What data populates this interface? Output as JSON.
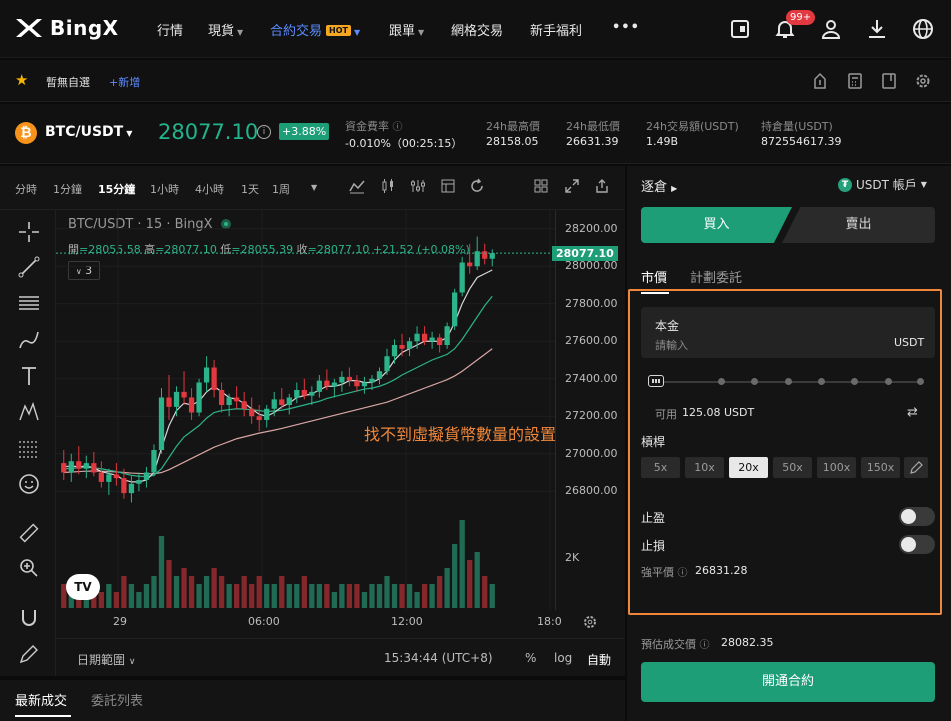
{
  "brand": {
    "name": "BingX"
  },
  "nav": {
    "items": [
      {
        "label": "行情",
        "caret": false
      },
      {
        "label": "現貨",
        "caret": true
      },
      {
        "label": "合約交易",
        "caret": true,
        "badge": "HOT",
        "active": true
      },
      {
        "label": "跟單",
        "caret": true
      },
      {
        "label": "網格交易",
        "caret": false
      },
      {
        "label": "新手福利",
        "caret": false
      }
    ],
    "more": "•••",
    "notifications_badge": "99+"
  },
  "favorites": {
    "label": "暫無自選",
    "add_label": "+新增"
  },
  "ticker": {
    "pair": "BTC/USDT",
    "last_price": "28077.10",
    "change": "+3.88%",
    "stats": [
      {
        "label": "資金費率",
        "value": "-0.010%（00:25:15）"
      },
      {
        "label": "24h最高價",
        "value": "28158.05"
      },
      {
        "label": "24h最低價",
        "value": "26631.39"
      },
      {
        "label": "24h交易額(USDT)",
        "value": "1.49B"
      },
      {
        "label": "持倉量(USDT)",
        "value": "872554617.39"
      }
    ]
  },
  "chart_toolbar": {
    "timeframes": [
      "分時",
      "1分鐘",
      "15分鐘",
      "1小時",
      "4小時",
      "1天",
      "1周"
    ],
    "active": "15分鐘"
  },
  "chart_header": {
    "title": "BTC/USDT · 15 · BingX",
    "ohlc": {
      "open_label": "開",
      "open": "=28055.58",
      "high_label": "高",
      "high": "=28077.10",
      "low_label": "低",
      "low": "=28055.39",
      "close_label": "收",
      "close": "=28077.10",
      "change": "+21.52 (+0.08%)"
    },
    "indicator_count": "3"
  },
  "annotation": "找不到虛擬貨幣數量的設置",
  "chart_footer": {
    "date_range": "日期範圍",
    "clock": "15:34:44 (UTC+8)",
    "percent": "%",
    "log": "log",
    "auto": "自動"
  },
  "tv_logo": "TV",
  "chart_data": {
    "type": "candlestick",
    "price_ticks": [
      28200,
      28000,
      27800,
      27600,
      27400,
      27200,
      27000,
      26800
    ],
    "price_tick_labels": [
      "28200.00",
      "28000.00",
      "27800.00",
      "27600.00",
      "27400.00",
      "27200.00",
      "27000.00",
      "26800.00"
    ],
    "current_price_label": "28077.10",
    "volume_tick_label": "2K",
    "time_ticks": [
      "29",
      "06:00",
      "12:00",
      "18:0"
    ],
    "ylim": [
      26700,
      28300
    ],
    "ohlc": [
      [
        26950,
        27020,
        26860,
        26900
      ],
      [
        26900,
        27000,
        26850,
        26960
      ],
      [
        26960,
        27040,
        26890,
        26920
      ],
      [
        26920,
        26990,
        26870,
        26950
      ],
      [
        26950,
        27010,
        26880,
        26900
      ],
      [
        26900,
        26960,
        26820,
        26850
      ],
      [
        26850,
        26920,
        26780,
        26890
      ],
      [
        26890,
        26950,
        26830,
        26870
      ],
      [
        26870,
        26920,
        26760,
        26790
      ],
      [
        26790,
        26880,
        26740,
        26840
      ],
      [
        26840,
        26900,
        26800,
        26860
      ],
      [
        26860,
        26930,
        26820,
        26900
      ],
      [
        26900,
        27050,
        26880,
        27020
      ],
      [
        27020,
        27350,
        27000,
        27300
      ],
      [
        27300,
        27420,
        27180,
        27250
      ],
      [
        27250,
        27360,
        27200,
        27330
      ],
      [
        27330,
        27440,
        27260,
        27300
      ],
      [
        27300,
        27350,
        27180,
        27220
      ],
      [
        27220,
        27400,
        27200,
        27380
      ],
      [
        27380,
        27520,
        27330,
        27460
      ],
      [
        27460,
        27500,
        27300,
        27340
      ],
      [
        27340,
        27380,
        27220,
        27260
      ],
      [
        27260,
        27320,
        27200,
        27300
      ],
      [
        27300,
        27360,
        27240,
        27280
      ],
      [
        27280,
        27330,
        27200,
        27240
      ],
      [
        27240,
        27300,
        27160,
        27200
      ],
      [
        27200,
        27260,
        27120,
        27180
      ],
      [
        27180,
        27260,
        27140,
        27240
      ],
      [
        27240,
        27330,
        27200,
        27290
      ],
      [
        27290,
        27350,
        27240,
        27260
      ],
      [
        27260,
        27320,
        27210,
        27300
      ],
      [
        27300,
        27380,
        27270,
        27340
      ],
      [
        27340,
        27400,
        27290,
        27310
      ],
      [
        27310,
        27360,
        27260,
        27330
      ],
      [
        27330,
        27420,
        27300,
        27390
      ],
      [
        27390,
        27450,
        27340,
        27360
      ],
      [
        27360,
        27400,
        27300,
        27380
      ],
      [
        27380,
        27440,
        27330,
        27410
      ],
      [
        27410,
        27460,
        27360,
        27390
      ],
      [
        27390,
        27420,
        27330,
        27360
      ],
      [
        27360,
        27410,
        27320,
        27380
      ],
      [
        27380,
        27420,
        27340,
        27400
      ],
      [
        27400,
        27460,
        27370,
        27440
      ],
      [
        27440,
        27560,
        27420,
        27520
      ],
      [
        27520,
        27610,
        27480,
        27580
      ],
      [
        27580,
        27640,
        27520,
        27560
      ],
      [
        27560,
        27620,
        27520,
        27600
      ],
      [
        27600,
        27680,
        27560,
        27640
      ],
      [
        27640,
        27680,
        27580,
        27600
      ],
      [
        27600,
        27650,
        27560,
        27620
      ],
      [
        27620,
        27640,
        27540,
        27580
      ],
      [
        27580,
        27700,
        27560,
        27680
      ],
      [
        27680,
        27880,
        27660,
        27860
      ],
      [
        27860,
        28050,
        27840,
        28020
      ],
      [
        28020,
        28120,
        27960,
        28000
      ],
      [
        28000,
        28158,
        27980,
        28080
      ],
      [
        28080,
        28120,
        28010,
        28040
      ],
      [
        28040,
        28090,
        28000,
        28070
      ]
    ],
    "volume": [
      3,
      2,
      4,
      2,
      3,
      2,
      3,
      2,
      4,
      3,
      2,
      3,
      4,
      9,
      6,
      4,
      5,
      4,
      3,
      4,
      5,
      4,
      3,
      3,
      4,
      3,
      4,
      3,
      3,
      4,
      3,
      3,
      4,
      3,
      3,
      3,
      2,
      3,
      3,
      3,
      2,
      3,
      3,
      4,
      3,
      3,
      3,
      2,
      3,
      3,
      4,
      5,
      8,
      11,
      6,
      7,
      4,
      3
    ],
    "ma_fast": [
      26930,
      26935,
      26930,
      26935,
      26925,
      26905,
      26895,
      26885,
      26860,
      26850,
      26850,
      26860,
      26900,
      27030,
      27150,
      27230,
      27270,
      27260,
      27280,
      27330,
      27360,
      27330,
      27300,
      27290,
      27270,
      27240,
      27210,
      27200,
      27220,
      27250,
      27270,
      27300,
      27310,
      27320,
      27340,
      27360,
      27360,
      27370,
      27390,
      27390,
      27380,
      27380,
      27400,
      27440,
      27500,
      27540,
      27560,
      27580,
      27600,
      27600,
      27600,
      27620,
      27700,
      27800,
      27880,
      27940,
      27960,
      27980
    ],
    "ma_mid": [
      26920,
      26922,
      26925,
      26927,
      26925,
      26920,
      26912,
      26905,
      26895,
      26885,
      26880,
      26878,
      26885,
      26920,
      26980,
      27040,
      27090,
      27120,
      27150,
      27190,
      27220,
      27230,
      27235,
      27240,
      27238,
      27235,
      27230,
      27225,
      27228,
      27232,
      27240,
      27250,
      27260,
      27270,
      27280,
      27295,
      27305,
      27315,
      27325,
      27335,
      27345,
      27350,
      27360,
      27375,
      27395,
      27420,
      27440,
      27460,
      27480,
      27500,
      27515,
      27530,
      27560,
      27610,
      27670,
      27730,
      27790,
      27840
    ],
    "ma_slow": [
      26900,
      26902,
      26905,
      26907,
      26908,
      26907,
      26905,
      26903,
      26900,
      26897,
      26895,
      26893,
      26893,
      26900,
      26915,
      26935,
      26955,
      26975,
      26995,
      27015,
      27035,
      27050,
      27065,
      27080,
      27090,
      27100,
      27110,
      27118,
      27126,
      27135,
      27145,
      27155,
      27165,
      27175,
      27185,
      27195,
      27205,
      27215,
      27225,
      27235,
      27245,
      27255,
      27265,
      27275,
      27290,
      27305,
      27320,
      27335,
      27350,
      27365,
      27380,
      27395,
      27415,
      27440,
      27470,
      27500,
      27530,
      27560
    ]
  },
  "order_panel": {
    "margin_mode": "逐倉",
    "account": "USDT 帳戶",
    "buy_label": "買入",
    "sell_label": "賣出",
    "tabs": [
      "市價",
      "計劃委託"
    ],
    "amount": {
      "label": "本金",
      "placeholder": "請輸入",
      "unit": "USDT",
      "value": ""
    },
    "slider_fraction": 0,
    "available_label": "可用",
    "available_value": "125.08 USDT",
    "leverage_label": "槓桿",
    "leverage_options": [
      "5x",
      "10x",
      "20x",
      "50x",
      "100x",
      "150x"
    ],
    "leverage_selected": "20x",
    "take_profit_label": "止盈",
    "take_profit_on": false,
    "stop_loss_label": "止損",
    "stop_loss_on": false,
    "liq_label": "強平價",
    "liq_value": "26831.28",
    "est_label": "預估成交價",
    "est_value": "28082.35",
    "open_button": "開通合約"
  },
  "trades": {
    "tabs": [
      "最新成交",
      "委託列表"
    ]
  },
  "colors": {
    "up": "#2cb38a",
    "down": "#e2383f",
    "accent": "#1d9e76",
    "highlight": "#f0873a",
    "ma_fast": "#d8d8d8",
    "ma_mid": "#2cb38a",
    "ma_slow": "#d9a6a6"
  }
}
